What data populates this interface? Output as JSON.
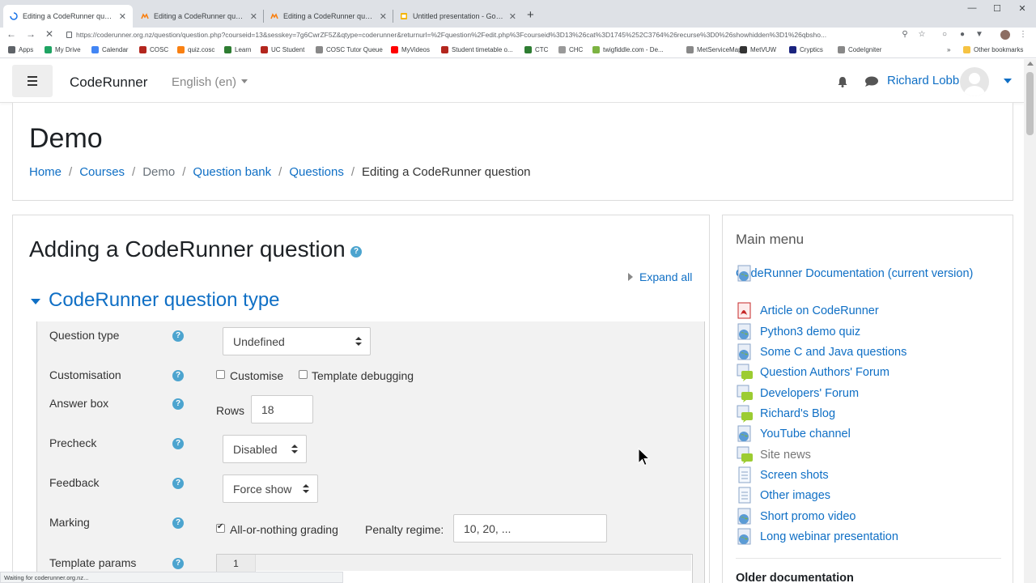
{
  "browser": {
    "tabs": [
      {
        "title": "Editing a CodeRunner question",
        "active": true
      },
      {
        "title": "Editing a CodeRunner question",
        "active": false
      },
      {
        "title": "Editing a CodeRunner question",
        "active": false
      },
      {
        "title": "Untitled presentation - Google S",
        "active": false
      }
    ],
    "tab_close_glyph": "✕",
    "new_tab_glyph": "+",
    "url": "https://coderunner.org.nz/question/question.php?courseid=13&sesskey=7g6CwrZF5Z&qtype=coderunner&returnurl=%2Fquestion%2Fedit.php%3Fcourseid%3D13%26cat%3D1745%252C3764%26recurse%3D0%26showhidden%3D1%26qbsho...",
    "bookmarks": [
      {
        "label": "Apps",
        "icon": "apps-grid-icon",
        "color": "#5f6368"
      },
      {
        "label": "My Drive",
        "icon": "drive-icon",
        "color": "#1fa463"
      },
      {
        "label": "Calendar",
        "icon": "calendar-icon",
        "color": "#4285f4"
      },
      {
        "label": "COSC",
        "icon": "crest-icon",
        "color": "#b3261e"
      },
      {
        "label": "quiz.cosc",
        "icon": "moodle-icon",
        "color": "#f98012"
      },
      {
        "label": "Learn",
        "icon": "learn-icon",
        "color": "#2e7d32"
      },
      {
        "label": "UC Student",
        "icon": "crest-icon",
        "color": "#b3261e"
      },
      {
        "label": "COSC Tutor Queue",
        "icon": "page-icon",
        "color": "#888888"
      },
      {
        "label": "MyVideos",
        "icon": "youtube-icon",
        "color": "#ff0000"
      },
      {
        "label": "Student timetable o...",
        "icon": "crest-icon",
        "color": "#b3261e"
      },
      {
        "label": "CTC",
        "icon": "ctc-icon",
        "color": "#2e7d32"
      },
      {
        "label": "CHC",
        "icon": "cloud-icon",
        "color": "#999999"
      },
      {
        "label": "twigfiddle.com - De...",
        "icon": "twig-icon",
        "color": "#7cb342"
      },
      {
        "label": "MetServiceMap",
        "icon": "page-icon",
        "color": "#888888"
      },
      {
        "label": "MetVUW",
        "icon": "metvuw-icon",
        "color": "#333333"
      },
      {
        "label": "Cryptics",
        "icon": "cryptics-icon",
        "color": "#1a237e"
      },
      {
        "label": "CodeIgniter",
        "icon": "page-icon",
        "color": "#888888"
      }
    ],
    "other_bookmarks": "Other bookmarks",
    "status_text": "Waiting for coderunner.org.nz..."
  },
  "navbar": {
    "brand": "CodeRunner",
    "language": "English (en)",
    "user_name": "Richard Lobb"
  },
  "header": {
    "title": "Demo",
    "breadcrumb": [
      "Home",
      "Courses",
      "Demo",
      "Question bank",
      "Questions",
      "Editing a CodeRunner question"
    ],
    "separator": "/"
  },
  "form": {
    "heading": "Adding a CodeRunner question",
    "expand_all": "Expand all",
    "section_title": "CodeRunner question type",
    "help_glyph": "?",
    "fields": {
      "question_type": {
        "label": "Question type",
        "value": "Undefined"
      },
      "customisation": {
        "label": "Customisation",
        "customise": "Customise",
        "customise_checked": false,
        "template_debugging": "Template debugging",
        "template_debugging_checked": false
      },
      "answer_box": {
        "label": "Answer box",
        "rows_label": "Rows",
        "rows_value": "18"
      },
      "precheck": {
        "label": "Precheck",
        "value": "Disabled"
      },
      "feedback": {
        "label": "Feedback",
        "value": "Force show"
      },
      "marking": {
        "label": "Marking",
        "all_or_nothing": "All-or-nothing grading",
        "all_or_nothing_checked": true,
        "penalty_label": "Penalty regime:",
        "penalty_value": "10, 20, ..."
      },
      "template_params": {
        "label": "Template params",
        "line_number": "1"
      }
    }
  },
  "main_menu": {
    "title": "Main menu",
    "items": [
      {
        "label": "CodeRunner Documentation (current version)",
        "icon": "globe-icon"
      },
      {
        "label": "Article on CodeRunner",
        "icon": "pdf-icon"
      },
      {
        "label": "Python3 demo quiz",
        "icon": "globe-icon"
      },
      {
        "label": "Some C and Java questions",
        "icon": "globe-icon"
      },
      {
        "label": "Question Authors' Forum",
        "icon": "forum-icon"
      },
      {
        "label": "Developers' Forum",
        "icon": "forum-icon"
      },
      {
        "label": "Richard's Blog",
        "icon": "forum-icon"
      },
      {
        "label": "YouTube channel",
        "icon": "globe-icon"
      },
      {
        "label": "Site news",
        "icon": "forum-icon"
      },
      {
        "label": "Screen shots",
        "icon": "page-icon"
      },
      {
        "label": "Other images",
        "icon": "page-icon"
      },
      {
        "label": "Short promo video",
        "icon": "globe-icon"
      },
      {
        "label": "Long webinar presentation",
        "icon": "globe-icon"
      }
    ],
    "older_docs": "Older documentation"
  },
  "colors": {
    "link": "#0f6fc5",
    "help_icon": "#4ca4cf",
    "fieldset_bg": "#f2f2f2"
  }
}
